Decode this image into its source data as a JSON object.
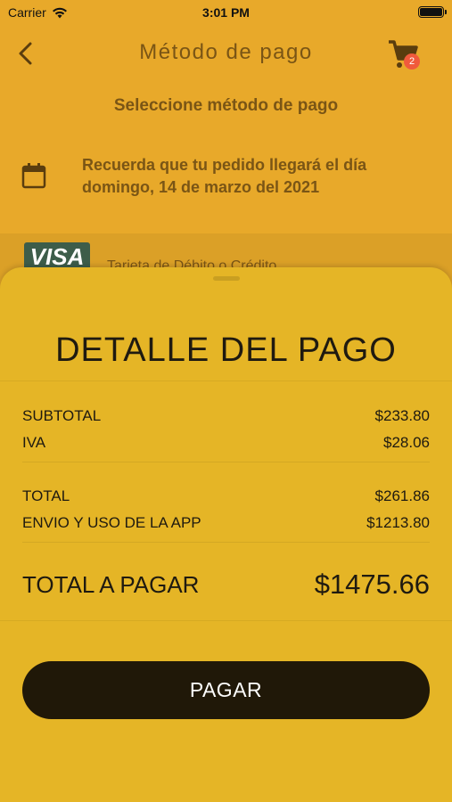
{
  "status_bar": {
    "carrier": "Carrier",
    "time": "3:01 PM"
  },
  "nav": {
    "title": "Método de pago",
    "cart_count": "2"
  },
  "subtitle": "Seleccione método de pago",
  "delivery_notice": "Recuerda que tu pedido llegará el día domingo, 14 de marzo del 2021",
  "payment_option": {
    "logo_text": "VISA",
    "label": "Tarjeta de Débito o Crédito"
  },
  "payment_detail": {
    "title": "DETALLE DEL PAGO",
    "subtotal_label": "SUBTOTAL",
    "subtotal_value": "$233.80",
    "iva_label": "IVA",
    "iva_value": "$28.06",
    "total_label": "TOTAL",
    "total_value": "$261.86",
    "envio_label": "ENVIO Y USO DE LA APP",
    "envio_value": "$1213.80",
    "grand_label": "TOTAL A PAGAR",
    "grand_value": "$1475.66",
    "pay_button": "PAGAR"
  },
  "colors": {
    "background": "#e8a92a",
    "sheet": "#e5b526",
    "button": "#201808",
    "badge": "#f05a3c"
  }
}
